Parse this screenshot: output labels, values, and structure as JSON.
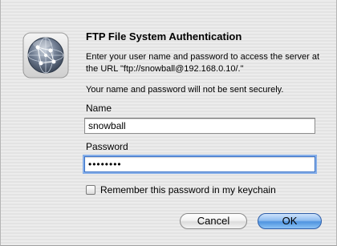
{
  "dialog": {
    "icon": "network-globe-icon",
    "title": "FTP File System Authentication",
    "message": "Enter your user name and password to access the server at the URL \"ftp://snowball@192.168.0.10/.\"",
    "notice": "Your name and password will not be sent securely.",
    "name_label": "Name",
    "name_value": "snowball",
    "password_label": "Password",
    "password_value": "••••••••",
    "remember_label": "Remember this password in my keychain",
    "remember_checked": false,
    "cancel_label": "Cancel",
    "ok_label": "OK",
    "accent_color": "#4f94e0"
  }
}
